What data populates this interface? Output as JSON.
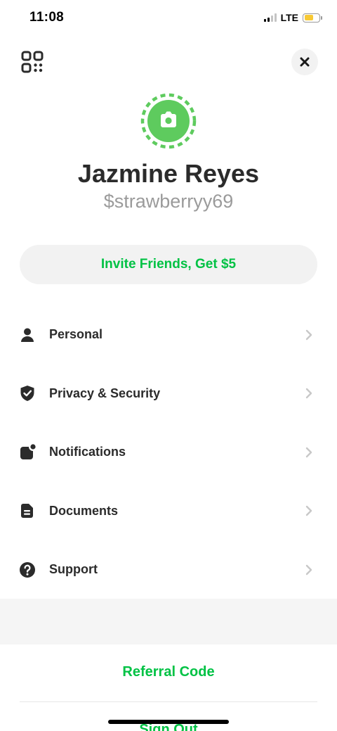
{
  "status_bar": {
    "time": "11:08",
    "network": "LTE",
    "battery_color": "#f7c936"
  },
  "header": {
    "qr_icon": "qr-code-icon",
    "close_icon": "close-icon"
  },
  "profile": {
    "avatar_icon": "camera-icon",
    "avatar_color": "#5ecb5e",
    "name": "Jazmine Reyes",
    "cashtag": "$strawberryy69"
  },
  "invite": {
    "label": "Invite Friends, Get $5",
    "color": "#00c244"
  },
  "menu": {
    "items": [
      {
        "label": "Personal",
        "icon": "person-icon"
      },
      {
        "label": "Privacy & Security",
        "icon": "shield-check-icon"
      },
      {
        "label": "Notifications",
        "icon": "notification-badge-icon"
      },
      {
        "label": "Documents",
        "icon": "document-icon"
      },
      {
        "label": "Support",
        "icon": "help-circle-icon"
      }
    ]
  },
  "footer": {
    "referral_label": "Referral Code",
    "signout_label": "Sign Out"
  }
}
